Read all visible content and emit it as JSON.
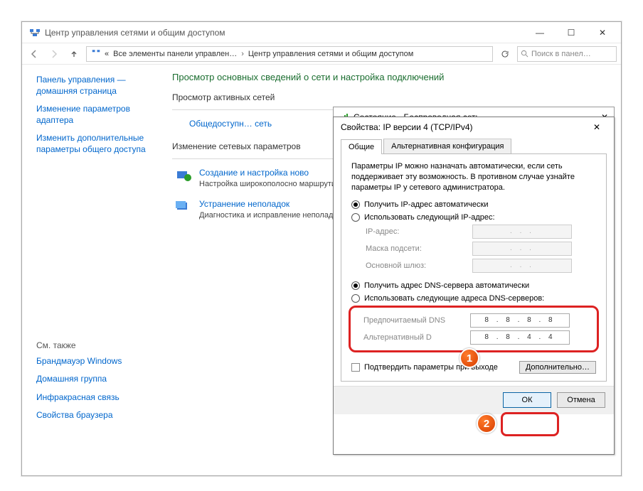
{
  "window": {
    "title": "Центр управления сетями и общим доступом",
    "controls": {
      "min": "—",
      "max": "☐",
      "close": "✕"
    }
  },
  "breadcrumb": {
    "items": [
      "«",
      "Все элементы панели управлен…",
      "Центр управления сетями и общим доступом"
    ]
  },
  "search": {
    "placeholder": "Поиск в панел…"
  },
  "sidebar": {
    "links": [
      "Панель управления — домашняя страница",
      "Изменение параметров адаптера",
      "Изменить дополнительные параметры общего доступа"
    ],
    "also_label": "См. также",
    "also": [
      "Брандмауэр Windows",
      "Домашняя группа",
      "Инфракрасная связь",
      "Свойства браузера"
    ]
  },
  "content": {
    "heading": "Просмотр основных сведений о сети и настройка подключений",
    "active_section": "Просмотр активных сетей",
    "network_name": "Общедоступн… сеть",
    "change_section": "Изменение сетевых параметров",
    "task1": {
      "title": "Создание и настройка ново",
      "desc": "Настройка широкополосно\nмаршрутизатора или точки"
    },
    "task2": {
      "title": "Устранение неполадок",
      "desc": "Диагностика и исправление\nнеполадок."
    }
  },
  "status_dialog": {
    "title": "Состояние - Беспроводная сеть"
  },
  "prop_dialog": {
    "title": "Свойства: IP версии 4 (TCP/IPv4)",
    "tab_general": "Общие",
    "tab_alt": "Альтернативная конфигурация",
    "desc": "Параметры IP можно назначать автоматически, если сеть поддерживает эту возможность. В противном случае узнайте параметры IP у сетевого администратора.",
    "radio_ip_auto": "Получить IP-адрес автоматически",
    "radio_ip_manual": "Использовать следующий IP-адрес:",
    "label_ip": "IP-адрес:",
    "label_mask": "Маска подсети:",
    "label_gw": "Основной шлюз:",
    "radio_dns_auto": "Получить адрес DNS-сервера автоматически",
    "radio_dns_manual": "Использовать следующие адреса DNS-серверов:",
    "label_dns1": "Предпочитаемый DNS",
    "label_dns2": "Альтернативный D",
    "dns1": "8 . 8 . 8 . 8",
    "dns2": "8 . 8 . 4 . 4",
    "validate": "Подтвердить параметры при выходе",
    "advanced": "Дополнительно…",
    "ok": "ОК",
    "cancel": "Отмена"
  },
  "badges": {
    "one": "1",
    "two": "2"
  }
}
